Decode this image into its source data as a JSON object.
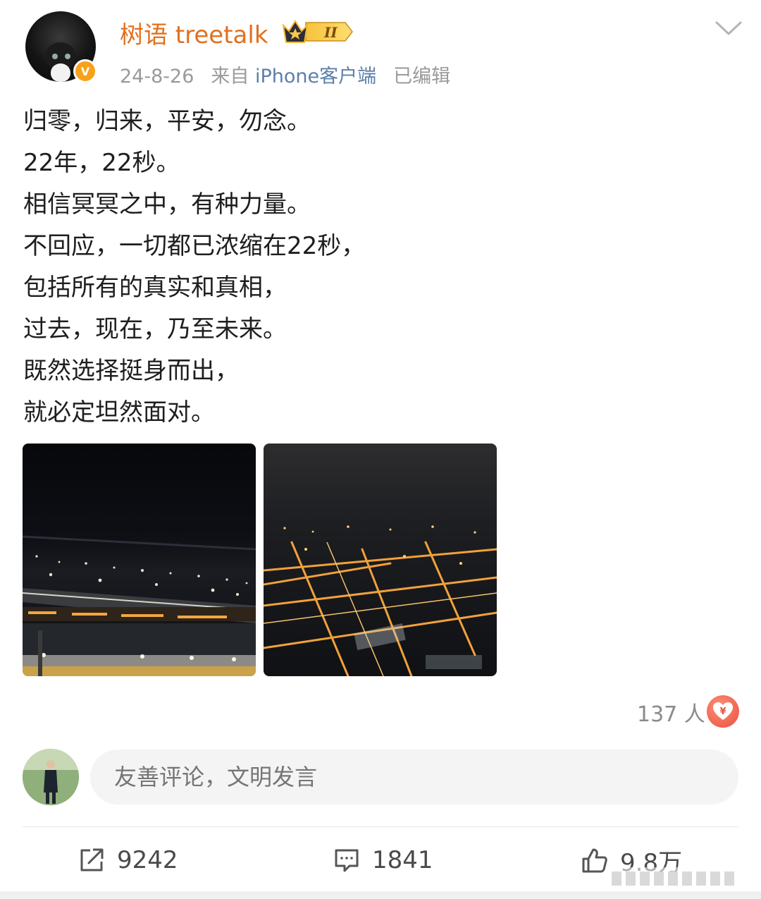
{
  "header": {
    "username": "树语 treetalk",
    "badge_icon": "crown-level-badge",
    "verified_icon": "verified-v-badge",
    "date": "24-8-26",
    "source_prefix": "来自",
    "source": "iPhone客户端",
    "edited": "已编辑",
    "username_color": "#e2701d"
  },
  "post": {
    "lines": [
      "归零，归来，平安，勿念。",
      "22年，22秒。",
      "相信冥冥之中，有种力量。",
      "不回应，一切都已浓缩在22秒，",
      "包括所有的真实和真相，",
      "过去，现在，乃至未来。",
      "既然选择挺身而出，",
      "就必定坦然面对。"
    ],
    "images": [
      "night-airport-photo",
      "night-city-aerial-photo"
    ]
  },
  "reward": {
    "count": "137 人",
    "icon": "reward-yuan-heart-icon"
  },
  "comment": {
    "placeholder": "友善评论，文明发言"
  },
  "actions": {
    "repost": "9242",
    "comments": "1841",
    "likes": "9.8万"
  },
  "colors": {
    "link": "#5b7fa8",
    "meta": "#9a9a9a",
    "reward": "#e8503c"
  }
}
